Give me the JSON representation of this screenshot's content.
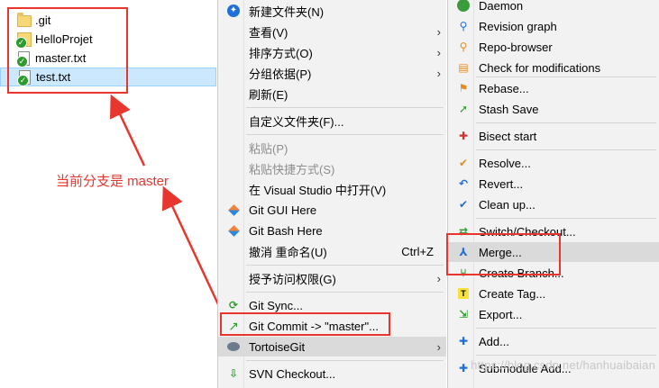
{
  "files": [
    {
      "name": ".git",
      "icon": "folder-icon",
      "badge": false
    },
    {
      "name": "HelloProjet",
      "icon": "folder-icon",
      "badge": true
    },
    {
      "name": "master.txt",
      "icon": "document-icon",
      "badge": true
    },
    {
      "name": "test.txt",
      "icon": "document-icon",
      "badge": true,
      "selected": true
    }
  ],
  "annotation": {
    "text": "当前分支是 master",
    "color": "#e8352e"
  },
  "explorer_menu": {
    "items": [
      {
        "label": "新建文件夹(N)",
        "icon": "new-folder-icon"
      },
      {
        "label": "查看(V)",
        "submenu": true
      },
      {
        "label": "排序方式(O)",
        "submenu": true
      },
      {
        "label": "分组依据(P)",
        "submenu": true
      },
      {
        "label": "刷新(E)"
      },
      {
        "label": "自定义文件夹(F)..."
      },
      {
        "label": "粘贴(P)",
        "disabled": true
      },
      {
        "label": "粘贴快捷方式(S)",
        "disabled": true
      },
      {
        "label": "在 Visual Studio 中打开(V)"
      },
      {
        "label": "Git GUI Here",
        "icon": "git-icon"
      },
      {
        "label": "Git Bash Here",
        "icon": "git-icon"
      },
      {
        "label": "撤消 重命名(U)",
        "shortcut": "Ctrl+Z"
      },
      {
        "label": "授予访问权限(G)",
        "submenu": true
      },
      {
        "label": "Git Sync...",
        "icon": "sync-icon"
      },
      {
        "label": "Git Commit -> \"master\"...",
        "icon": "commit-icon"
      },
      {
        "label": "TortoiseGit",
        "icon": "tortoisegit-icon",
        "submenu": true,
        "highlighted": true
      },
      {
        "label": "SVN Checkout...",
        "icon": "svn-checkout-icon"
      }
    ]
  },
  "tortoise_menu": {
    "items": [
      {
        "label": "Daemon",
        "icon": "daemon-icon"
      },
      {
        "label": "Revision graph",
        "icon": "revision-graph-icon"
      },
      {
        "label": "Repo-browser",
        "icon": "repo-browser-icon"
      },
      {
        "label": "Check for modifications",
        "icon": "check-modifications-icon"
      },
      {
        "label": "Rebase...",
        "icon": "rebase-icon"
      },
      {
        "label": "Stash Save",
        "icon": "stash-icon"
      },
      {
        "label": "Bisect start",
        "icon": "bisect-icon"
      },
      {
        "label": "Resolve...",
        "icon": "resolve-icon"
      },
      {
        "label": "Revert...",
        "icon": "revert-icon"
      },
      {
        "label": "Clean up...",
        "icon": "cleanup-icon"
      },
      {
        "label": "Switch/Checkout...",
        "icon": "switch-icon"
      },
      {
        "label": "Merge...",
        "icon": "merge-icon",
        "highlighted": true
      },
      {
        "label": "Create Branch...",
        "icon": "branch-icon"
      },
      {
        "label": "Create Tag...",
        "icon": "tag-icon"
      },
      {
        "label": "Export...",
        "icon": "export-icon"
      },
      {
        "label": "Add...",
        "icon": "add-icon"
      },
      {
        "label": "Submodule Add...",
        "icon": "submodule-icon"
      }
    ]
  },
  "watermark": "https://blog.csdn.net/hanhuaibaian",
  "colors": {
    "highlight": "#e8352e",
    "menu_bg": "#f2f2f2",
    "hover": "#dadada",
    "selection": "#cce8ff"
  }
}
